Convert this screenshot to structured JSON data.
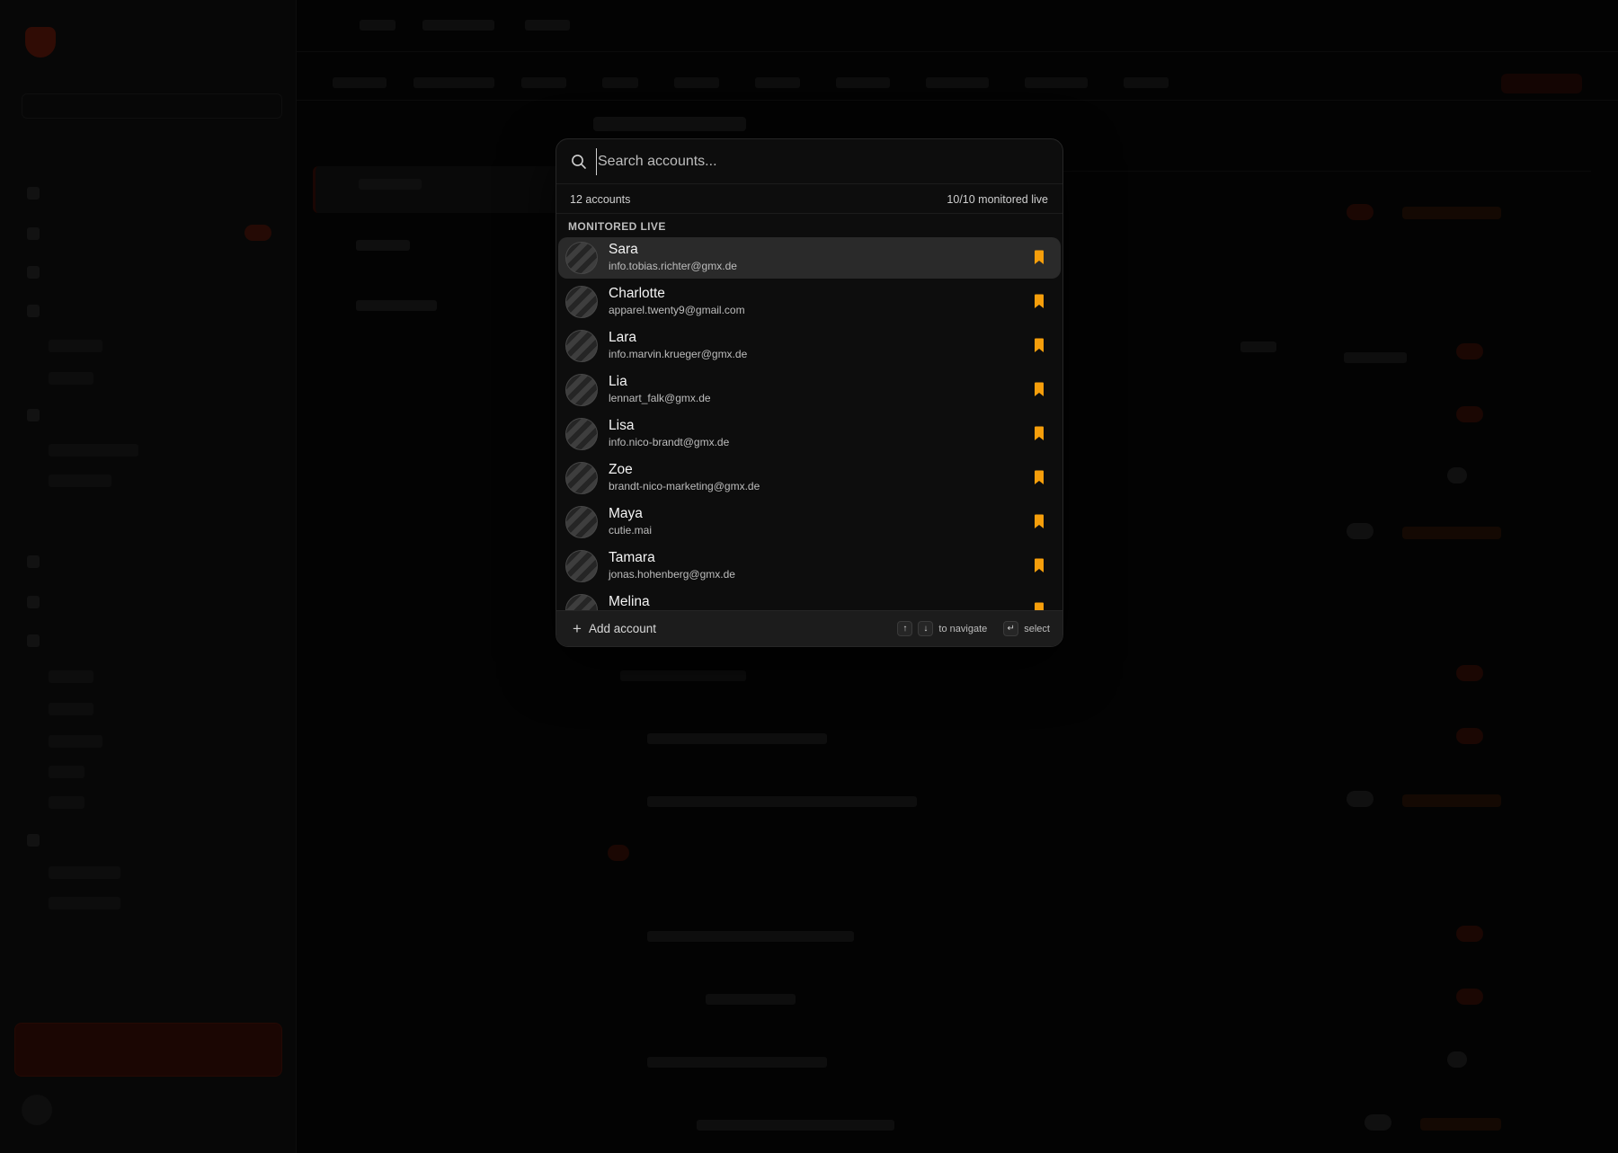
{
  "palette": {
    "search_placeholder": "Search accounts...",
    "account_count": "12 accounts",
    "monitored_status": "10/10 monitored live",
    "group_label": "MONITORED LIVE",
    "accent_color": "#f59e0b",
    "accounts": [
      {
        "name": "Sara",
        "email": "info.tobias.richter@gmx.de",
        "selected": true
      },
      {
        "name": "Charlotte",
        "email": "apparel.twenty9@gmail.com"
      },
      {
        "name": "Lara",
        "email": "info.marvin.krueger@gmx.de"
      },
      {
        "name": "Lia",
        "email": "lennart_falk@gmx.de"
      },
      {
        "name": "Lisa",
        "email": "info.nico-brandt@gmx.de"
      },
      {
        "name": "Zoe",
        "email": "brandt-nico-marketing@gmx.de"
      },
      {
        "name": "Maya",
        "email": "cutie.mai"
      },
      {
        "name": "Tamara",
        "email": "jonas.hohenberg@gmx.de"
      },
      {
        "name": "Melina",
        "email": ""
      }
    ],
    "footer": {
      "add_label": "Add account",
      "nav_hint": "to navigate",
      "select_hint": "select",
      "up_key": "↑",
      "down_key": "↓",
      "enter_key": "↵",
      "plus_icon": "+"
    }
  }
}
